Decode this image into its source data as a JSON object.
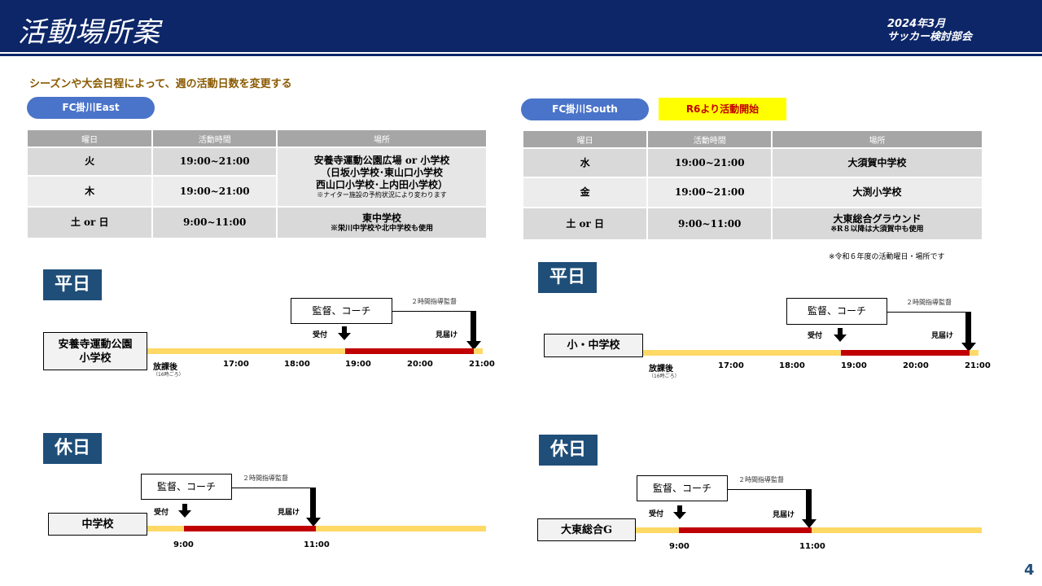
{
  "header": {
    "title": "活動場所案",
    "date": "2024年3月",
    "org": "サッカー検討部会"
  },
  "subtitle": "シーズンや大会日程によって、週の活動日数を変更する",
  "east": {
    "team": "FC掛川East",
    "headers": [
      "曜日",
      "活動時間",
      "場所"
    ],
    "rows": [
      {
        "day": "火",
        "time": "19:00~21:00"
      },
      {
        "day": "木",
        "time": "19:00~21:00"
      },
      {
        "day": "土 or 日",
        "time": "9:00~11:00"
      }
    ],
    "place1_line1": "安養寺運動公園広場 or 小学校",
    "place1_line2": "（日坂小学校･東山口小学校",
    "place1_line3": "西山口小学校･上内田小学校）",
    "place1_note": "※ナイター施設の予約状況により変わります",
    "place2": "東中学校",
    "place2_note": "※栄川中学校や北中学校も使用"
  },
  "south": {
    "team": "FC掛川South",
    "notice": "R6より活動開始",
    "headers": [
      "曜日",
      "活動時間",
      "場所"
    ],
    "rows": [
      {
        "day": "水",
        "time": "19:00~21:00",
        "place": "大須賀中学校",
        "note": ""
      },
      {
        "day": "金",
        "time": "19:00~21:00",
        "place": "大渕小学校",
        "note": ""
      },
      {
        "day": "土 or 日",
        "time": "9:00~11:00",
        "place": "大東総合グラウンド",
        "note": "※R８以降は大須賀中も使用"
      }
    ],
    "footnote": "※令和６年度の活動曜日・場所です"
  },
  "weekday_label": "平日",
  "holiday_label": "休日",
  "staff": "監督、コーチ",
  "supervise": "２時間指導監督",
  "reception": "受付",
  "seeoff": "見届け",
  "after_school": "放課後",
  "after_school_sub": "（16時ごろ）",
  "weekday_ticks": [
    "17:00",
    "18:00",
    "19:00",
    "20:00",
    "21:00"
  ],
  "holiday_ticks": [
    "9:00",
    "11:00"
  ],
  "timelines": {
    "east_weekday_place": "安養寺運動公園\n小学校",
    "south_weekday_place": "小・中学校",
    "east_holiday_place": "中学校",
    "south_holiday_place": "大東総合G"
  },
  "page_number": "4",
  "colors": {
    "header": "#0c2668",
    "pill": "#4a74c9",
    "section": "#1f4e79",
    "bar_idle": "#ffd966",
    "bar_active": "#c00000",
    "notice_bg": "#ffff00",
    "notice_text": "#c00000"
  }
}
